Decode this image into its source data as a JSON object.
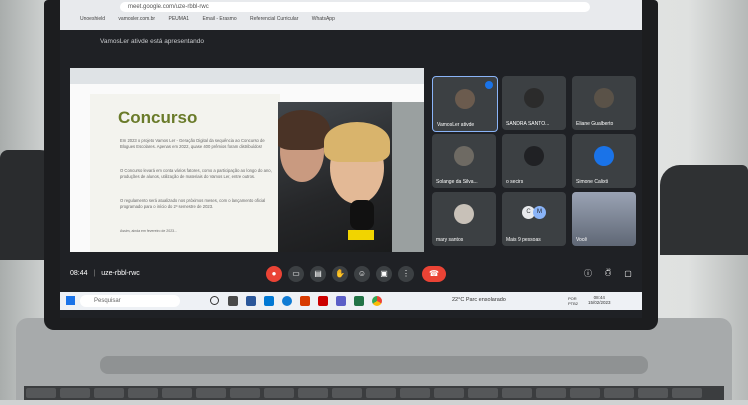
{
  "browser": {
    "address": "meet.google.com/uze-rbbl-rwc",
    "bookmarks": [
      "Unoeshield",
      "vamosler.com.br",
      "PEUMA1",
      "Email - Erasmo",
      "Referencial Curricular",
      "WhatsApp"
    ]
  },
  "meet": {
    "presenting_text": "VamosLer ativde está apresentando",
    "time": "08:44",
    "meeting_code": "uze-rbbl-rwc"
  },
  "slide": {
    "title": "Concurso",
    "bullets": [
      "Em 2023 o projeto Vamos Ler - Geração Digital da sequência ao Concurso de Blogues Escolares. Apenas em 2022, quase 400 prêmios foram distribuídos!",
      "O Concurso levará em conta vários fatores, como a participação ao longo do ano, produções de alunos, utilização de materiais do Vamos Ler, entre outros.",
      "O regulamento será atualizado nos próximos meses, com o lançamento oficial programado para o início do 2º semestre de 2023.",
      "Assim, ainda em fevereiro de 2023..."
    ]
  },
  "participants": [
    {
      "name": "VamosLer ativde"
    },
    {
      "name": "SANDRA SANTO..."
    },
    {
      "name": "Eliane Gualberto"
    },
    {
      "name": "Solange da Silva..."
    },
    {
      "name": "o secirs"
    },
    {
      "name": "Simone Calixti"
    },
    {
      "name": "mary santos"
    },
    {
      "name": "Mais 9 pessoas"
    },
    {
      "name": "Você"
    }
  ],
  "others_initials": [
    "C",
    "M"
  ],
  "participant_count": "19",
  "taskbar": {
    "search_placeholder": "Pesquisar",
    "weather": "22°C Parc ensolarado",
    "clock_time": "08:44",
    "clock_date": "15/02/2023",
    "lang": "POR PTB2"
  },
  "colors": {
    "hangup": "#ea4335",
    "mic_off": "#ea4335",
    "slide_title": "#6a7b2a",
    "active_tile_border": "#8ab4f8"
  }
}
